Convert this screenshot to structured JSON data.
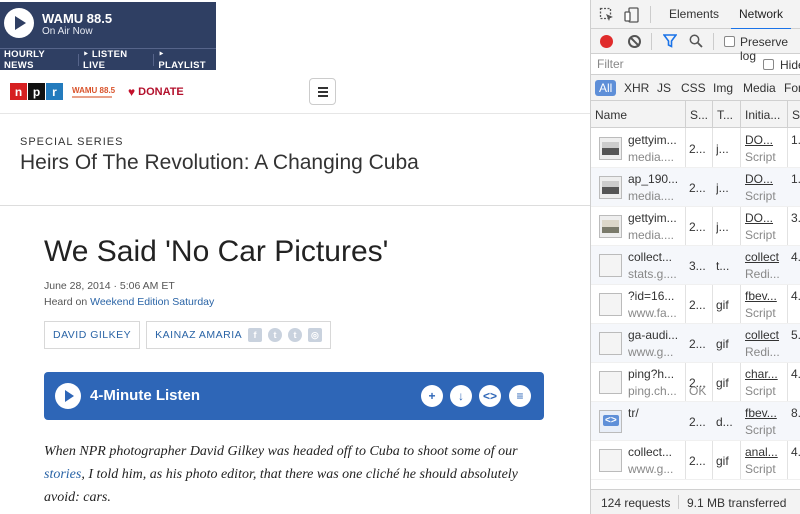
{
  "player": {
    "station": "WAMU 88.5",
    "status": "On Air Now",
    "links": [
      "HOURLY NEWS",
      "‣ LISTEN LIVE",
      "‣ PLAYLIST"
    ]
  },
  "nav": {
    "logo_letters": [
      "n",
      "p",
      "r"
    ],
    "station_logo": "WAMU 88.5",
    "donate": "DONATE"
  },
  "series": {
    "kicker": "SPECIAL SERIES",
    "title": "Heirs Of The Revolution: A Changing Cuba"
  },
  "article": {
    "headline": "We Said 'No Car Pictures'",
    "date": "June 28, 2014 · 5:06 AM ET",
    "heard_prefix": "Heard on ",
    "heard_show": "Weekend Edition Saturday",
    "authors": [
      "DAVID GILKEY",
      "KAINAZ AMARIA"
    ],
    "social_icons": [
      "facebook-icon",
      "twitter-icon",
      "tumblr-icon",
      "instagram-icon"
    ],
    "listen_label": "4-Minute Listen",
    "listen_actions": [
      "+",
      "↓",
      "<>",
      "≡"
    ],
    "body_before_link": "When NPR photographer David Gilkey was headed off to Cuba to shoot some of our ",
    "body_link": "stories",
    "body_after_link": ", I told him, as his photo editor, that there was one cliché he should absolutely avoid: cars."
  },
  "devtools": {
    "tabs": [
      "Elements",
      "Network"
    ],
    "active_tab": "Network",
    "preserve_log": "Preserve log",
    "filter_placeholder": "Filter",
    "hide_label": "Hide",
    "types": [
      "All",
      "XHR",
      "JS",
      "CSS",
      "Img",
      "Media",
      "Font"
    ],
    "active_type": "All",
    "columns": [
      "Name",
      "S...",
      "T...",
      "Initia...",
      "S..."
    ],
    "rows": [
      {
        "thumb": "img",
        "name": "gettyim...",
        "domain": "media....",
        "status": "2...",
        "type": "j...",
        "initiator": "DO...",
        "initiator_sub": "Script",
        "size": "1."
      },
      {
        "thumb": "img",
        "name": "ap_190...",
        "domain": "media....",
        "status": "2...",
        "type": "j...",
        "initiator": "DO...",
        "initiator_sub": "Script",
        "size": "1."
      },
      {
        "thumb": "img2",
        "name": "gettyim...",
        "domain": "media....",
        "status": "2...",
        "type": "j...",
        "initiator": "DO...",
        "initiator_sub": "Script",
        "size": "3."
      },
      {
        "thumb": "doc",
        "name": "collect...",
        "domain": "stats.g....",
        "status": "3...",
        "type": "t...",
        "initiator": "collect",
        "initiator_sub": "Redi...",
        "size": "4."
      },
      {
        "thumb": "doc",
        "name": "?id=16...",
        "domain": "www.fa...",
        "status": "2...",
        "type": "gif",
        "initiator": "fbev...",
        "initiator_sub": "Script",
        "size": "4."
      },
      {
        "thumb": "doc",
        "name": "ga-audi...",
        "domain": "www.g...",
        "status": "2...",
        "type": "gif",
        "initiator": "collect",
        "initiator_sub": "Redi...",
        "size": "5."
      },
      {
        "thumb": "doc",
        "name": "ping?h...",
        "domain": "ping.ch...",
        "status": "2...",
        "status_sub": "OK",
        "type": "gif",
        "initiator": "char...",
        "initiator_sub": "Script",
        "size": "4."
      },
      {
        "thumb": "script",
        "name": "tr/",
        "domain": "",
        "status": "2...",
        "type": "d...",
        "initiator": "fbev...",
        "initiator_sub": "Script",
        "size": "8."
      },
      {
        "thumb": "doc",
        "name": "collect...",
        "domain": "www.g...",
        "status": "2...",
        "type": "gif",
        "initiator": "anal...",
        "initiator_sub": "Script",
        "size": "4."
      }
    ],
    "requests": "124 requests",
    "transferred": "9.1 MB transferred"
  }
}
